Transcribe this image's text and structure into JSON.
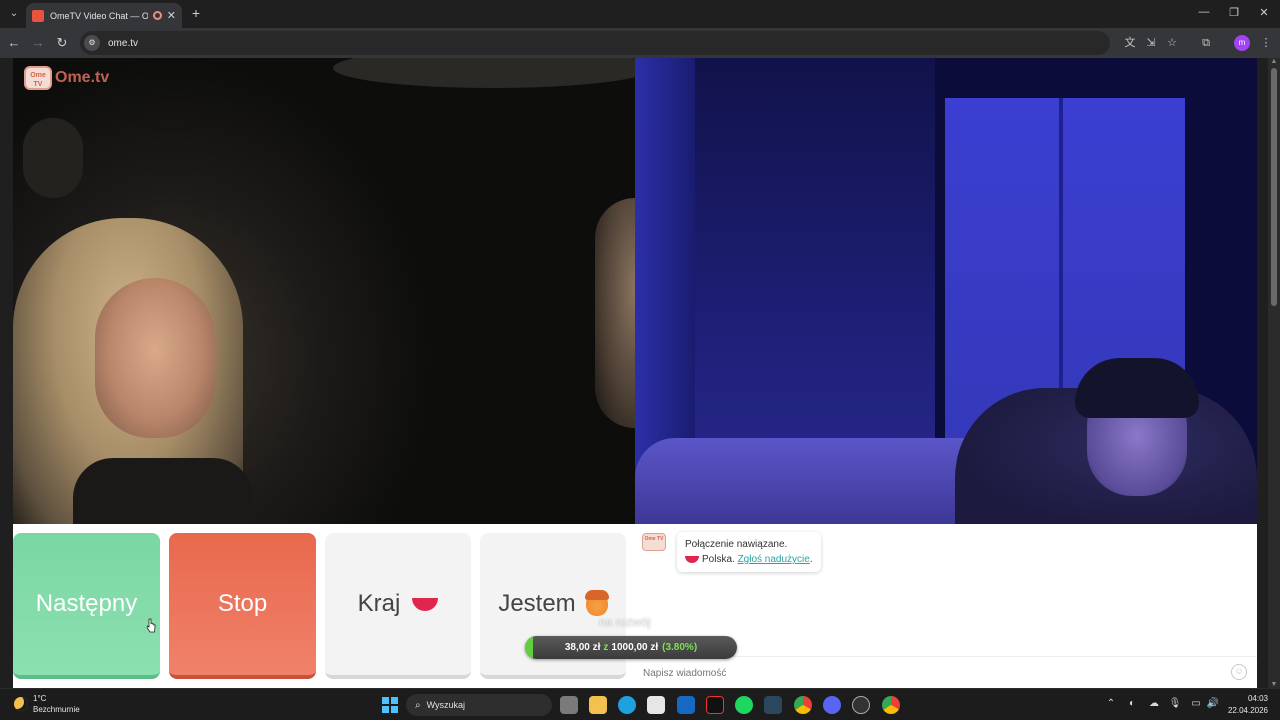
{
  "browser": {
    "tab_title": "OmeTV Video Chat — Ome",
    "tab_close": "✕",
    "new_tab": "+",
    "url": "ome.tv",
    "minimize": "—",
    "maximize": "❐",
    "close": "✕",
    "profile_initial": "m"
  },
  "logo": {
    "badge": "Ome TV",
    "text": "Ome.tv"
  },
  "buttons": {
    "next": "Następny",
    "stop": "Stop",
    "country": "Kraj",
    "gender": "Jestem"
  },
  "chat": {
    "sys_icon": "Ome TV",
    "status": "Połączenie nawiązane.",
    "country": "Polska.",
    "report_link": "Zgłoś nadużycie",
    "period": ".",
    "input_placeholder": "Napisz wiadomość",
    "emoji": "☺"
  },
  "donation": {
    "overlay_text": "na rozwój",
    "current": "38,00 zł",
    "of": "z",
    "goal": "1000,00 zł",
    "percent": "(3.80%)",
    "progress_fraction": 0.038
  },
  "taskbar": {
    "temperature": "1°C",
    "weather": "Bezchmurnie",
    "search_placeholder": "Wyszukaj",
    "time": "04:03",
    "date": "22.04.2026"
  },
  "colors": {
    "next_button": "#79d7a3",
    "stop_button": "#e8684d",
    "link": "#2aa3a3",
    "progress_fill": "#5fcf3f"
  }
}
